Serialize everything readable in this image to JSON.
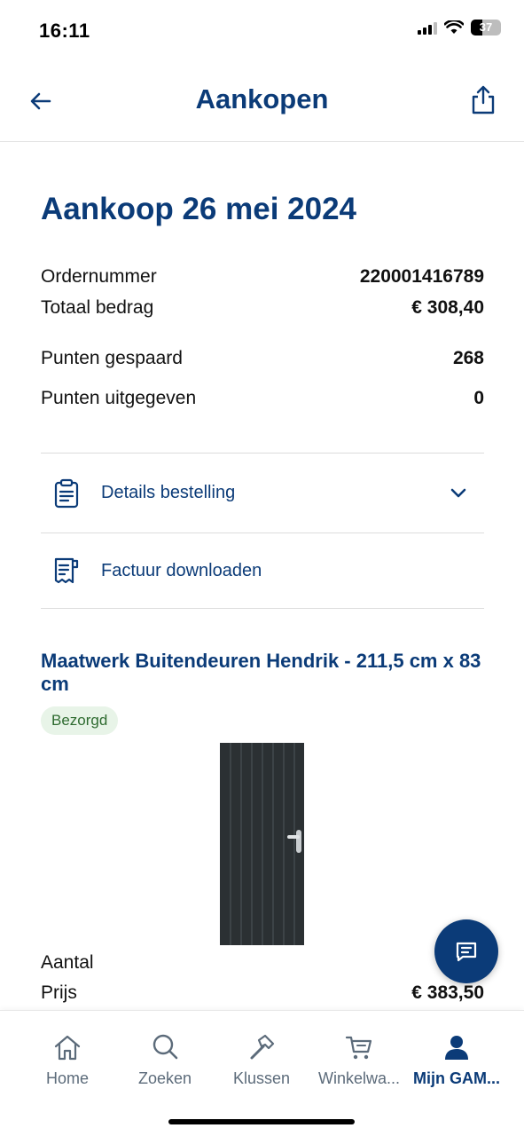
{
  "status": {
    "time": "16:11",
    "battery": "37"
  },
  "nav": {
    "title": "Aankopen",
    "back_icon": "arrow-left-icon",
    "share_icon": "share-icon"
  },
  "purchase": {
    "title": "Aankoop 26 mei 2024",
    "rows": [
      {
        "label": "Ordernummer",
        "value": "220001416789"
      },
      {
        "label": "Totaal bedrag",
        "value": "€ 308,40"
      },
      {
        "label": "Punten gespaard",
        "value": "268"
      },
      {
        "label": "Punten uitgegeven",
        "value": "0"
      }
    ]
  },
  "actions": [
    {
      "label": "Details bestelling",
      "icon": "clipboard-icon"
    },
    {
      "label": "Factuur downloaden",
      "icon": "invoice-icon"
    }
  ],
  "product": {
    "title": "Maatwerk Buitendeuren Hendrik - 211,5 cm x 83 cm",
    "status": "Bezorgd",
    "quantity_label": "Aantal",
    "price_label": "Prijs",
    "price_value": "€ 383,50"
  },
  "tabs": [
    {
      "label": "Home",
      "icon": "home-icon"
    },
    {
      "label": "Zoeken",
      "icon": "search-icon"
    },
    {
      "label": "Klussen",
      "icon": "hammer-icon"
    },
    {
      "label": "Winkelwa...",
      "icon": "cart-icon"
    },
    {
      "label": "Mijn GAM...",
      "icon": "user-icon"
    }
  ],
  "colors": {
    "brand": "#0b3b78",
    "badge_bg": "#e8f4e8",
    "badge_text": "#2e6b30"
  }
}
